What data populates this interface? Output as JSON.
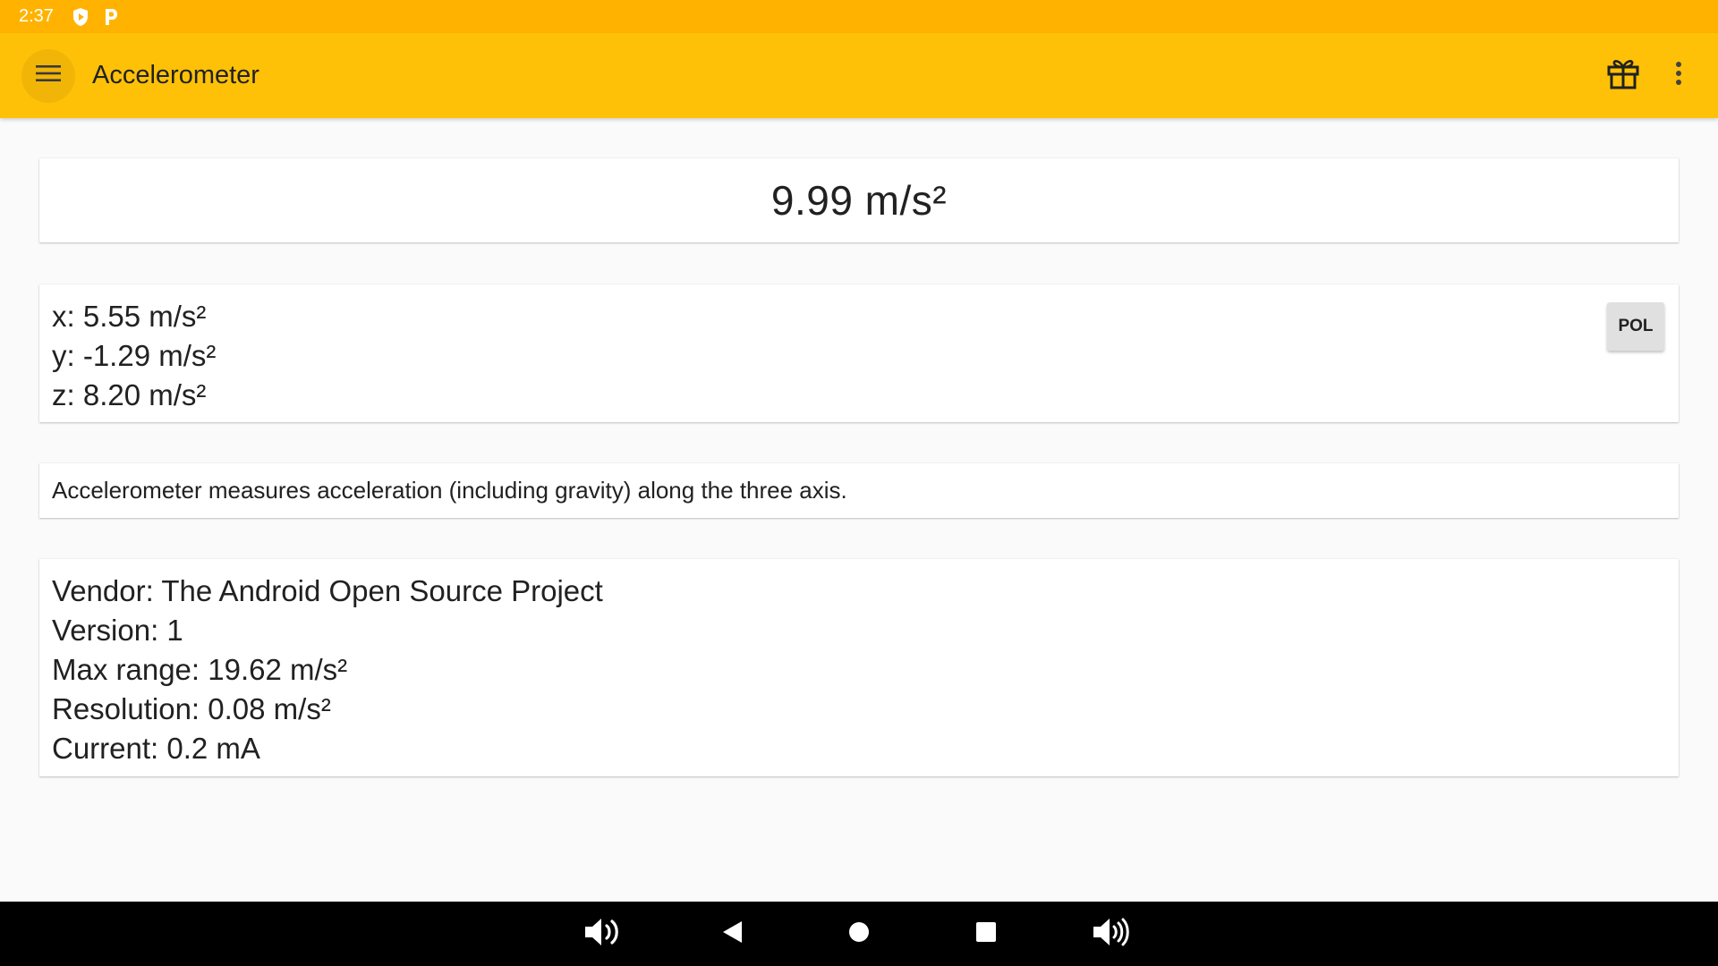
{
  "status_bar": {
    "time": "2:37",
    "icons": [
      "shield-play-icon",
      "parking-p-icon"
    ]
  },
  "app_bar": {
    "title": "Accelerometer",
    "menu_icon": "hamburger-menu-icon",
    "actions": [
      "gift-icon",
      "more-vert-icon"
    ]
  },
  "magnitude": {
    "value": "9.99 m/s²"
  },
  "axes": {
    "x_label": "x:",
    "x_value": "5.55 m/s²",
    "y_label": "y:",
    "y_value": "-1.29 m/s²",
    "z_label": "z:",
    "z_value": "8.20 m/s²",
    "pol_label": "POL"
  },
  "description": {
    "text": "Accelerometer measures acceleration (including gravity) along the three axis."
  },
  "sensor_info": {
    "vendor_label": "Vendor:",
    "vendor_value": "The Android Open Source Project",
    "version_label": "Version:",
    "version_value": "1",
    "max_range_label": "Max range:",
    "max_range_value": "19.62 m/s²",
    "resolution_label": "Resolution:",
    "resolution_value": "0.08 m/s²",
    "current_label": "Current:",
    "current_value": "0.2 mA"
  },
  "nav_bar": {
    "buttons": [
      "volume-down-icon",
      "back-icon",
      "home-icon",
      "recents-icon",
      "volume-up-icon"
    ]
  },
  "colors": {
    "status_bar": "#ffb300",
    "app_bar": "#ffc107",
    "background": "#fafafa",
    "card": "#ffffff",
    "nav_bar": "#000000"
  }
}
